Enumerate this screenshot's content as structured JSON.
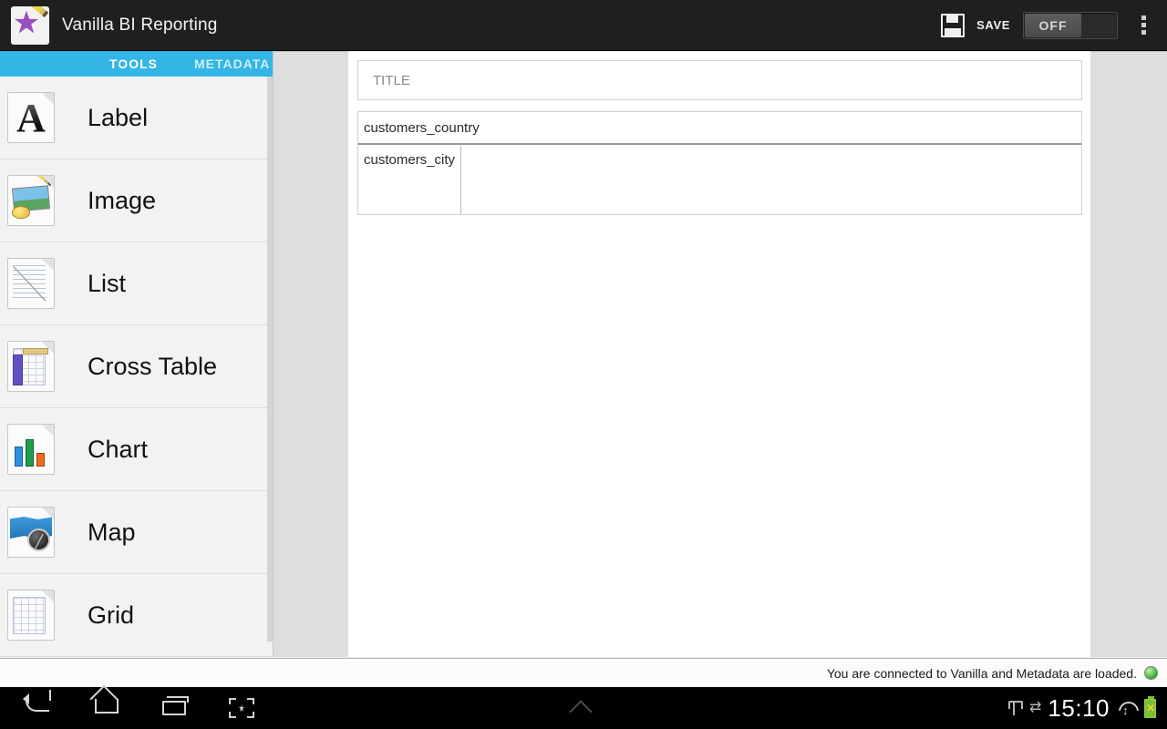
{
  "app": {
    "title": "Vanilla BI Reporting",
    "icon": "vanilla-app-icon"
  },
  "actionbar": {
    "save_icon": "floppy-disk-icon",
    "save_label": "SAVE",
    "toggle_state": "OFF",
    "overflow_icon": "overflow-menu-icon"
  },
  "tabs": [
    {
      "label": "TOOLS",
      "selected": true
    },
    {
      "label": "METADATA",
      "selected": false
    }
  ],
  "tools": [
    {
      "label": "Label",
      "icon": "label-tool-icon"
    },
    {
      "label": "Image",
      "icon": "image-tool-icon"
    },
    {
      "label": "List",
      "icon": "list-tool-icon"
    },
    {
      "label": "Cross Table",
      "icon": "cross-table-tool-icon"
    },
    {
      "label": "Chart",
      "icon": "chart-tool-icon"
    },
    {
      "label": "Map",
      "icon": "map-tool-icon"
    },
    {
      "label": "Grid",
      "icon": "grid-tool-icon"
    }
  ],
  "canvas": {
    "title_band": "TITLE",
    "group_band": "customers_country",
    "detail_cell": "customers_city"
  },
  "status": {
    "message": "You are connected to Vanilla and Metadata are loaded.",
    "led": "green-status-led",
    "led_color": "#36aa2e"
  },
  "navbar": {
    "back": "back-icon",
    "home": "home-icon",
    "recents": "recent-apps-icon",
    "screenshot": "screenshot-icon",
    "expand": "chevron-up-icon",
    "usb": "usb-icon",
    "sync": "sync-icon",
    "clock": "15:10",
    "wifi": "wifi-icon",
    "battery": "battery-icon"
  },
  "theme": {
    "accent": "#33b5e5",
    "actionbar_bg": "#1f1f1f",
    "panel_bg": "#f2f2f2",
    "gutter_bg": "#dedede"
  }
}
